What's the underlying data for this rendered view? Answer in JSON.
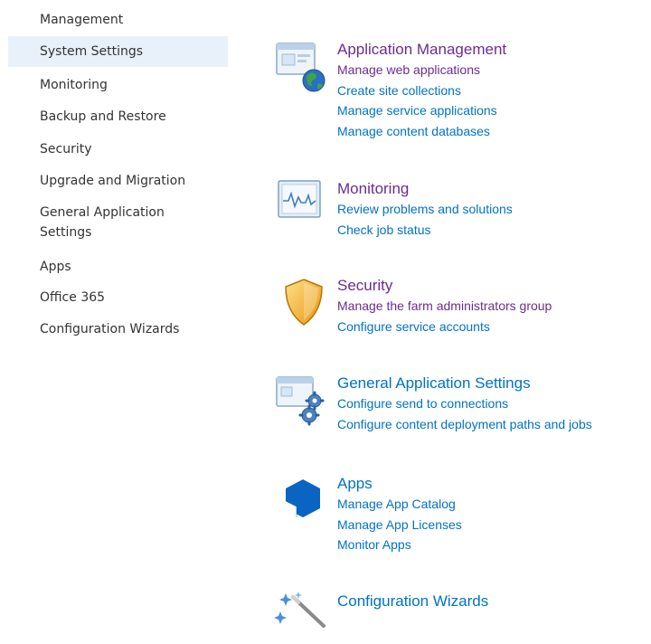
{
  "sidebar": {
    "items": [
      {
        "label": "Management"
      },
      {
        "label": "System Settings",
        "selected": true
      },
      {
        "label": "Monitoring"
      },
      {
        "label": "Backup and Restore"
      },
      {
        "label": "Security"
      },
      {
        "label": "Upgrade and Migration"
      },
      {
        "label": "General Application Settings"
      },
      {
        "label": "Apps"
      },
      {
        "label": "Office 365"
      },
      {
        "label": "Configuration Wizards"
      }
    ]
  },
  "sections": [
    {
      "title": "Application Management",
      "icon": "application-management-globe-icon",
      "links": [
        "Manage web applications",
        "Create site collections",
        "Manage service applications",
        "Manage content databases"
      ]
    },
    {
      "title": "Monitoring",
      "icon": "monitoring-pulse-icon",
      "links": [
        "Review problems and solutions",
        "Check job status"
      ]
    },
    {
      "title": "Security",
      "icon": "security-shield-icon",
      "links": [
        "Manage the farm administrators group",
        "Configure service accounts"
      ]
    },
    {
      "title": "General Application Settings",
      "icon": "settings-gears-icon",
      "links": [
        "Configure send to connections",
        "Configure content deployment paths and jobs"
      ]
    },
    {
      "title": "Apps",
      "icon": "apps-cube-icon",
      "links": [
        "Manage App Catalog",
        "Manage App Licenses",
        "Monitor Apps"
      ]
    },
    {
      "title": "Configuration Wizards",
      "icon": "configuration-wizard-wand-icon",
      "links": []
    }
  ],
  "colors": {
    "link": "#0072c6",
    "visited": "#6b2c91",
    "sidebar_text": "#333333",
    "sidebar_selected_bg": "#e8f1fa"
  }
}
